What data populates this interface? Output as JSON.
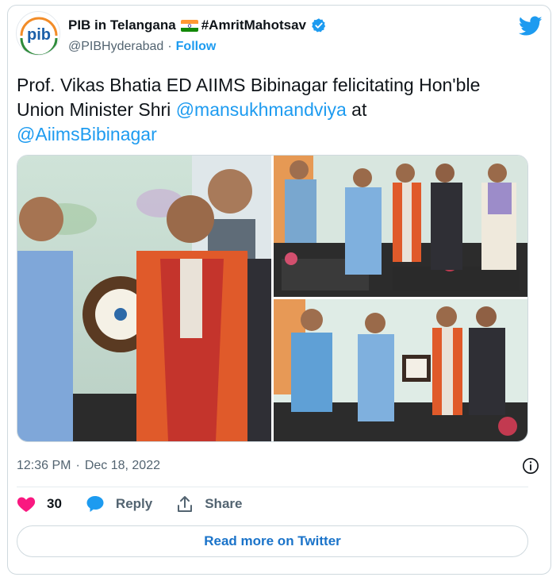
{
  "author": {
    "display_name": "PIB in Telangana",
    "hashtag": "#AmritMahotsav",
    "handle": "@PIBHyderabad",
    "separator": "·",
    "follow_label": "Follow",
    "verified_icon": "verified-badge-icon",
    "flag_icon": "india-flag-icon",
    "avatar_logo_text": "pib"
  },
  "tweet": {
    "text_part1": "Prof. Vikas Bhatia ED AIIMS Bibinagar felicitating Hon'ble Union Minister Shri ",
    "mention1": "@mansukhmandviya",
    "text_part2": " at ",
    "mention2": "@AiimsBibinagar"
  },
  "meta": {
    "time": "12:36 PM",
    "separator": "·",
    "date": "Dec 18, 2022"
  },
  "actions": {
    "like_count": "30",
    "reply_label": "Reply",
    "share_label": "Share"
  },
  "read_more_label": "Read more on Twitter",
  "colors": {
    "accent": "#1d9bf0",
    "like": "#f91880",
    "text": "#0f1419",
    "secondary": "#536471"
  }
}
